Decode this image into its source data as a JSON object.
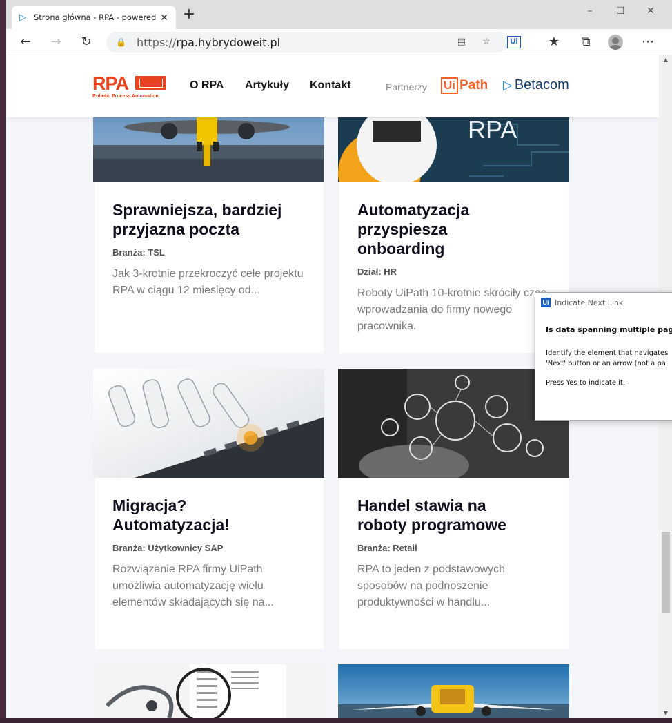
{
  "browser": {
    "tab_title": "Strona główna - RPA - powered b",
    "new_tab_symbol": "+",
    "url_protocol": "https://",
    "url_host": "rpa.hybrydoweit.pl",
    "win_minimize": "–",
    "win_maximize": "☐",
    "win_close": "✕"
  },
  "site": {
    "logo_text": "RPA",
    "logo_subtitle": "Robotic Process Automation",
    "nav": [
      "O RPA",
      "Artykuły",
      "Kontakt"
    ],
    "partners_label": "Partnerzy",
    "partner_uipath_ui": "Ui",
    "partner_uipath_path": "Path",
    "partner_betacom": "Betacom"
  },
  "cards": [
    {
      "title_lines": [
        "Sprawniejsza, bardziej",
        "przyjazna poczta"
      ],
      "meta": "Branża: TSL",
      "excerpt_lines": [
        "Jak 3-krotnie przekroczyć cele projektu",
        "RPA w ciągu 12 miesięcy od..."
      ]
    },
    {
      "title_lines": [
        "Automatyzacja",
        "przyspiesza",
        "onboarding"
      ],
      "meta": "Dział: HR",
      "excerpt_lines": [
        "Roboty UiPath 10-krotnie skróciły czas",
        "wprowadzania do firmy nowego",
        "pracownika."
      ],
      "image_text": "RPA"
    },
    {
      "title_lines": [
        "Migracja?",
        "Automatyzacja!"
      ],
      "meta": "Branża: Użytkownicy SAP",
      "excerpt_lines": [
        "Rozwiązanie RPA firmy UiPath",
        "umożliwia automatyzację wielu",
        "elementów składających się na..."
      ]
    },
    {
      "title_lines": [
        "Handel stawia na",
        "roboty programowe"
      ],
      "meta": "Branża: Retail",
      "excerpt_lines": [
        "RPA to jeden z podstawowych",
        "sposobów na podnoszenie",
        "produktywności w handlu..."
      ]
    }
  ],
  "dialog": {
    "icon_text": "Ui",
    "title": "Indicate Next Link",
    "heading": "Is data spanning multiple pages?",
    "body_lines": [
      "Identify the element that navigates",
      "'Next' button or an arrow (not a pa"
    ],
    "hint": "Press Yes to indicate it."
  }
}
